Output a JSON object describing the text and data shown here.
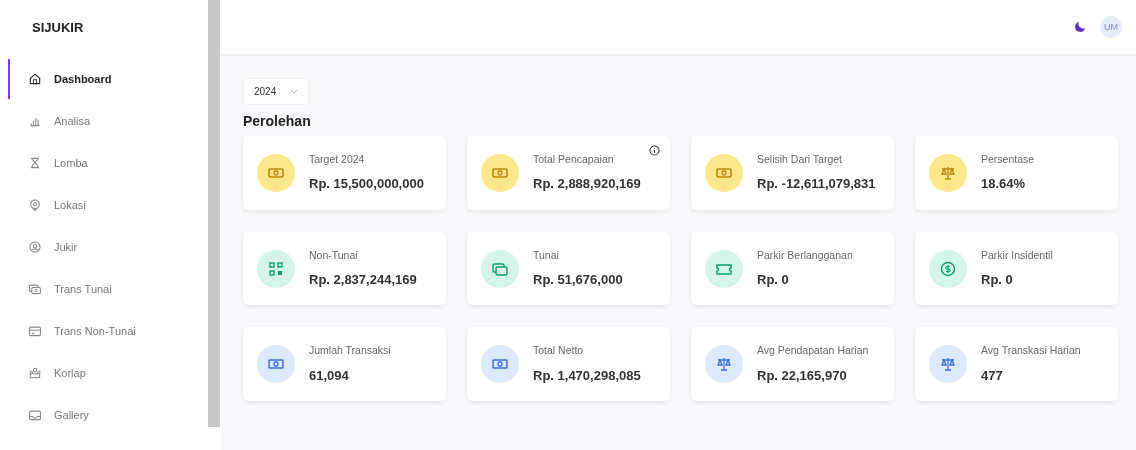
{
  "sidebar": {
    "logo": "SIJUKIR",
    "items": [
      {
        "label": "Dashboard",
        "selected": true
      },
      {
        "label": "Analisa",
        "selected": false
      },
      {
        "label": "Lomba",
        "selected": false
      },
      {
        "label": "Lokasi",
        "selected": false
      },
      {
        "label": "Jukir",
        "selected": false
      },
      {
        "label": "Trans Tunai",
        "selected": false
      },
      {
        "label": "Trans Non-Tunai",
        "selected": false
      },
      {
        "label": "Korlap",
        "selected": false
      },
      {
        "label": "Gallery",
        "selected": false
      }
    ]
  },
  "header": {
    "avatar": "UM"
  },
  "year_select": {
    "value": "2024"
  },
  "section_title": "Perolehan",
  "cards": [
    {
      "title": "Target 2024",
      "value": "Rp. 15,500,000,000",
      "color": "#fbe68a",
      "info": false
    },
    {
      "title": "Total Pencapaian",
      "value": "Rp. 2,888,920,169",
      "color": "#fbe68a",
      "info": true
    },
    {
      "title": "Selisih Dari Target",
      "value": "Rp. -12,611,079,831",
      "color": "#fbe68a",
      "info": false
    },
    {
      "title": "Persentase",
      "value": "18.64%",
      "color": "#fbe68a",
      "info": false
    },
    {
      "title": "Non-Tunai",
      "value": "Rp. 2,837,244,169",
      "color": "#d5f5e8",
      "info": false
    },
    {
      "title": "Tunai",
      "value": "Rp. 51,676,000",
      "color": "#d5f5e8",
      "info": false
    },
    {
      "title": "Parkir Berlangganan",
      "value": "Rp. 0",
      "color": "#d5f5e8",
      "info": false
    },
    {
      "title": "Parkir Insidentil",
      "value": "Rp. 0",
      "color": "#d5f5e8",
      "info": false
    },
    {
      "title": "Jumlah Transaksi",
      "value": "61,094",
      "color": "#dbeafe",
      "info": false
    },
    {
      "title": "Total Netto",
      "value": "Rp. 1,470,298,085",
      "color": "#dbeafe",
      "info": false
    },
    {
      "title": "Avg Pendapatan Harian",
      "value": "Rp. 22,165,970",
      "color": "#dbeafe",
      "info": false
    },
    {
      "title": "Avg Transkasi Harian",
      "value": "477",
      "color": "#dbeafe",
      "info": false
    }
  ]
}
